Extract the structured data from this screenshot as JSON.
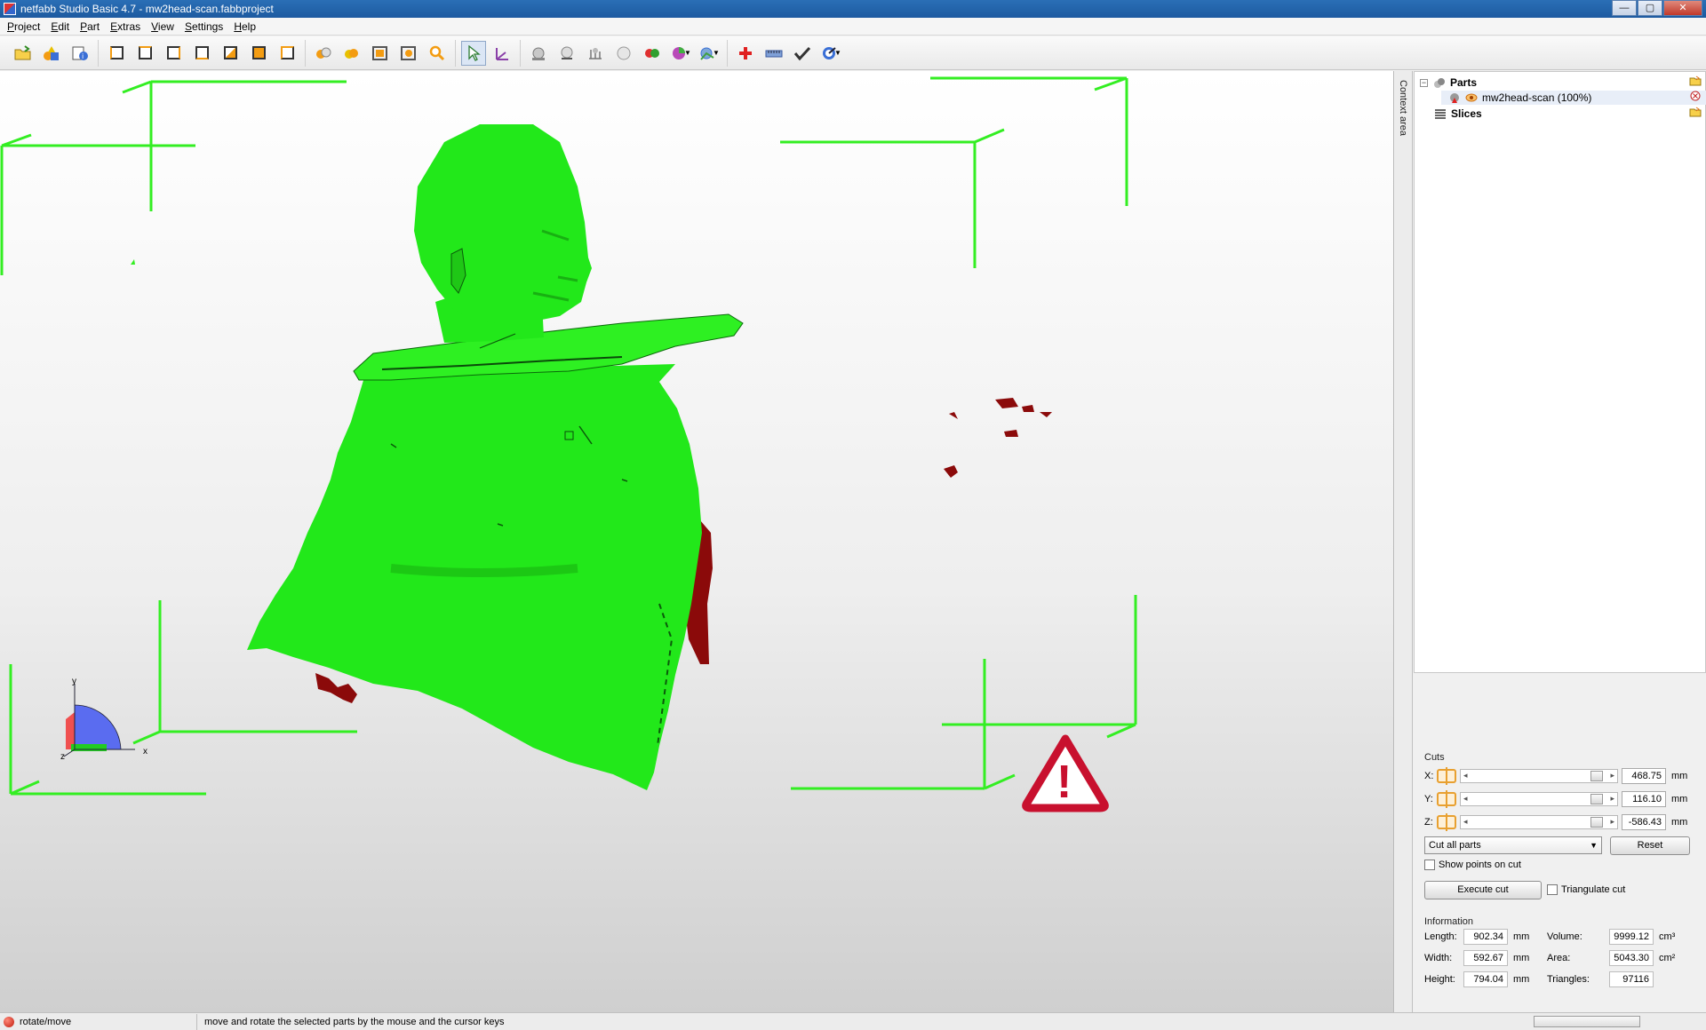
{
  "window": {
    "title": "netfabb Studio Basic 4.7 - mw2head-scan.fabbproject",
    "minimize": "—",
    "maximize": "▢",
    "close": "✕"
  },
  "menu": {
    "project": {
      "first": "P",
      "rest": "roject"
    },
    "edit": {
      "first": "E",
      "rest": "dit"
    },
    "part": {
      "first": "P",
      "rest": "art"
    },
    "extras": {
      "first": "E",
      "rest": "xtras"
    },
    "view": {
      "first": "V",
      "rest": "iew"
    },
    "settings": {
      "first": "S",
      "rest": "ettings"
    },
    "help": {
      "first": "H",
      "rest": "elp"
    }
  },
  "toolbar": {
    "icons": [
      "open-folder-icon",
      "add-part-icon",
      "part-info-icon",
      "view-front-icon",
      "view-back-icon",
      "view-left-icon",
      "view-right-icon",
      "view-top-icon",
      "view-bottom-icon",
      "view-iso-icon",
      "zoom-all-icon",
      "zoom-selected-icon",
      "zoom-window-icon",
      "zoom-part-icon",
      "zoom-icon",
      "select-icon",
      "coordinate-icon",
      "render-sphere-icon",
      "render-shade-icon",
      "render-wire-icon",
      "render-smooth-icon",
      "render-color-icon",
      "render-pie-icon",
      "measure-icon",
      "repair-icon",
      "ruler-icon",
      "check-icon",
      "shield-icon"
    ]
  },
  "viewport": {
    "axis_labels": {
      "x": "x",
      "y": "y",
      "z": "z"
    },
    "warning_symbol": "!",
    "model_color": "#22e81a",
    "frame_color": "#33ee22",
    "defect_color": "#8b0a0a"
  },
  "context_tab": "Context area",
  "tree": {
    "parts_label": "Parts",
    "part_name": "mw2head-scan (100%)",
    "slices_label": "Slices"
  },
  "cuts": {
    "label": "Cuts",
    "x": {
      "axis": "X:",
      "value": "468.75",
      "unit": "mm"
    },
    "y": {
      "axis": "Y:",
      "value": "116.10",
      "unit": "mm"
    },
    "z": {
      "axis": "Z:",
      "value": "-586.43",
      "unit": "mm"
    },
    "mode": "Cut all parts",
    "reset": "Reset",
    "show_points": "Show points on cut",
    "execute": "Execute cut",
    "triangulate": "Triangulate cut"
  },
  "information": {
    "label": "Information",
    "length": {
      "label": "Length:",
      "value": "902.34",
      "unit": "mm"
    },
    "width": {
      "label": "Width:",
      "value": "592.67",
      "unit": "mm"
    },
    "height": {
      "label": "Height:",
      "value": "794.04",
      "unit": "mm"
    },
    "volume": {
      "label": "Volume:",
      "value": "9999.12",
      "unit": "cm³"
    },
    "area": {
      "label": "Area:",
      "value": "5043.30",
      "unit": "cm²"
    },
    "triangles": {
      "label": "Triangles:",
      "value": "97116"
    }
  },
  "status": {
    "mode": "rotate/move",
    "message": "move and rotate the selected parts by the mouse and the cursor keys"
  }
}
